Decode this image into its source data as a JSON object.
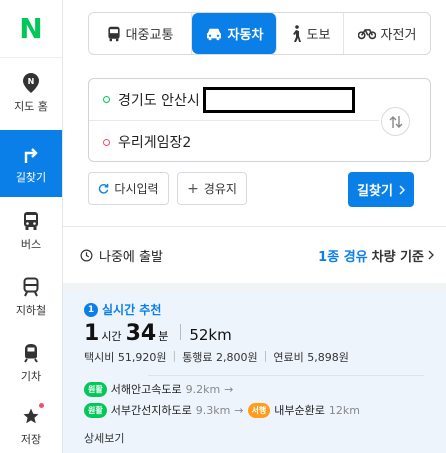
{
  "app": {
    "logo_letter": "N"
  },
  "sidebar": {
    "items": [
      {
        "label": "지도 홈",
        "icon": "map-pin-icon",
        "active": false
      },
      {
        "label": "길찾기",
        "icon": "turn-arrow-icon",
        "active": true
      },
      {
        "label": "버스",
        "icon": "bus-icon",
        "active": false
      },
      {
        "label": "지하철",
        "icon": "subway-icon",
        "active": false
      },
      {
        "label": "기차",
        "icon": "train-icon",
        "active": false
      },
      {
        "label": "저장",
        "icon": "star-icon",
        "active": false
      }
    ]
  },
  "tabs": [
    {
      "label": "대중교통",
      "icon": "bus-icon",
      "active": false
    },
    {
      "label": "자동차",
      "icon": "car-icon",
      "active": true
    },
    {
      "label": "도보",
      "icon": "walk-icon",
      "active": false
    },
    {
      "label": "자전거",
      "icon": "bicycle-icon",
      "active": false
    }
  ],
  "route": {
    "from": "경기도 안산시",
    "to": "우리게임장2"
  },
  "actions": {
    "reset": "다시입력",
    "waypoint": "경유지",
    "search": "길찾기"
  },
  "departure": {
    "label": "나중에 출발",
    "waypoint_info": "1종 경유",
    "criteria": "차량 기준"
  },
  "result": {
    "rank": "1",
    "title": "실시간 추천",
    "hours": "1",
    "hours_unit": "시간",
    "minutes": "34",
    "minutes_unit": "분",
    "distance": "52km",
    "taxi": "택시비 51,920원",
    "toll": "통행료 2,800원",
    "fuel": "연료비 5,898원",
    "roads": [
      {
        "tag": "원활",
        "name": "서해안고속도로",
        "km": "9.2km"
      },
      {
        "tag": "원활",
        "name": "서부간선지하도로",
        "km": "9.3km",
        "tag2": "서행",
        "name2": "내부순환로",
        "km2": "12km"
      }
    ],
    "detail": "상세보기"
  },
  "colors": {
    "brand_green": "#03c75a",
    "accent_blue": "#0b7fe8",
    "slow_orange": "#ff9d1c"
  }
}
